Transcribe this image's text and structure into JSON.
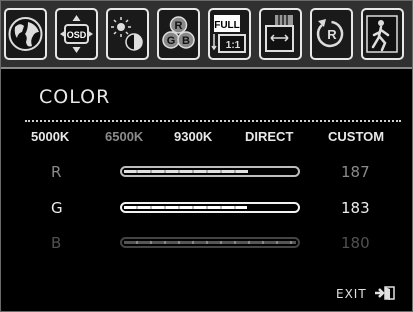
{
  "menu": {
    "title": "COLOR",
    "icons": [
      "globe-icon",
      "osd-icon",
      "brightness-contrast-icon",
      "rgb-icon",
      "full-scale-icon",
      "image-setup-icon",
      "reset-icon",
      "exit-figure-icon"
    ],
    "osd_icon_label": "OSD",
    "full_icon_label": "FULL",
    "ratio_icon_label": "1:1",
    "reset_icon_label": "R",
    "rgb_letters": [
      "R",
      "G",
      "B"
    ]
  },
  "presets": [
    {
      "label": "5000K",
      "active": true
    },
    {
      "label": "6500K",
      "active": false
    },
    {
      "label": "9300K",
      "active": true
    },
    {
      "label": "DIRECT",
      "active": true
    },
    {
      "label": "CUSTOM",
      "active": true
    }
  ],
  "channels": [
    {
      "label": "R",
      "value": "187",
      "level": 0.73,
      "state": "normal"
    },
    {
      "label": "G",
      "value": "183",
      "level": 0.72,
      "state": "selected"
    },
    {
      "label": "B",
      "value": "180",
      "level": 0.7,
      "state": "disabled"
    }
  ],
  "footer": {
    "exit_label": "EXIT"
  },
  "colors": {
    "background": "#000000",
    "iconbar": "#303030",
    "text": "#e8e8e8",
    "dim": "#8a8a8a",
    "disabled": "#555555"
  }
}
